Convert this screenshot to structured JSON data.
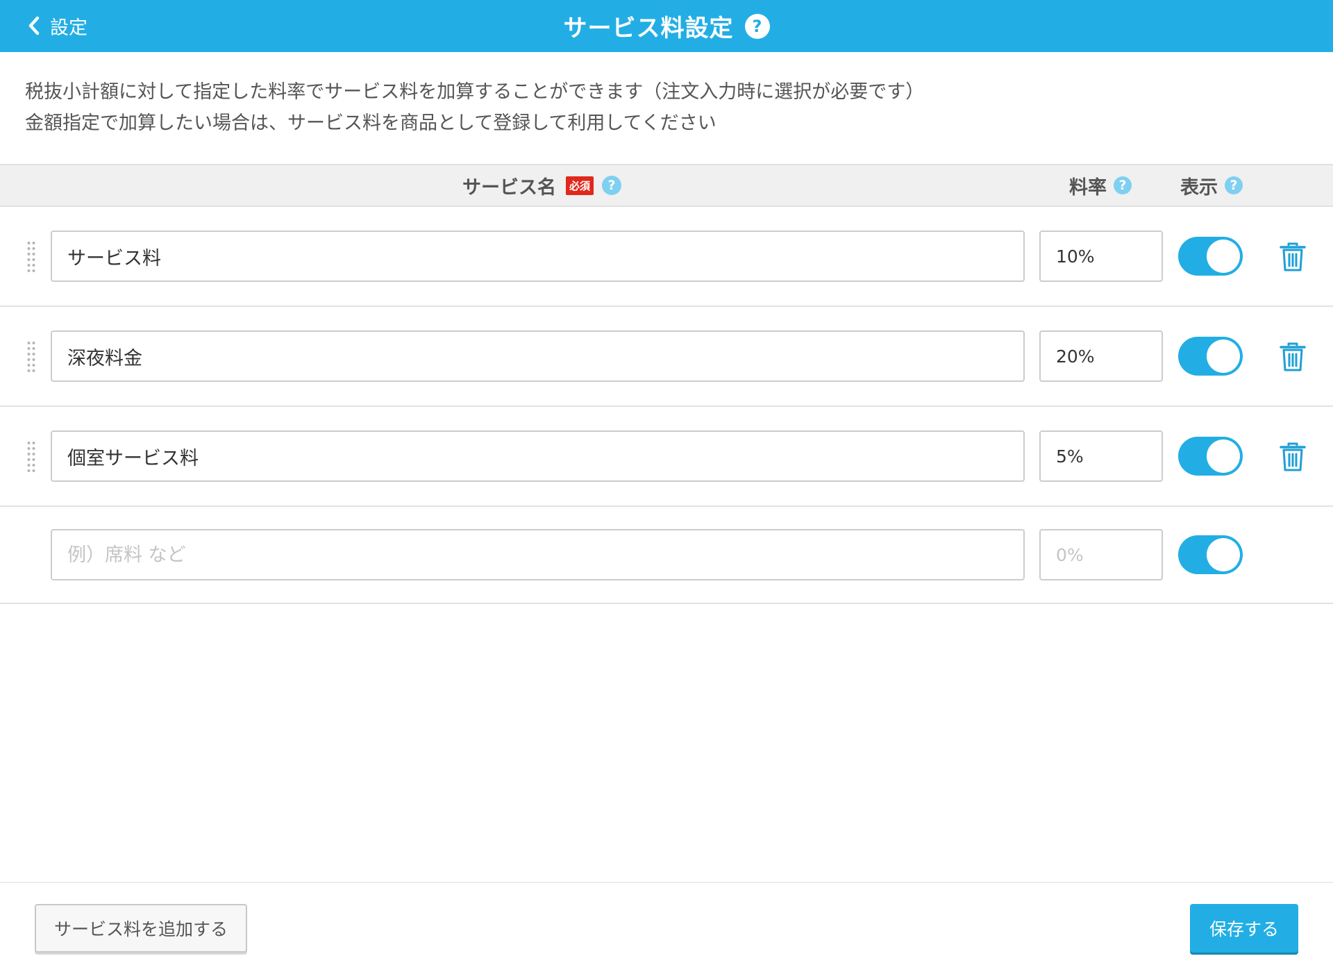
{
  "header": {
    "back_label": "設定",
    "title": "サービス料設定",
    "help_glyph": "?",
    "accent_color": "#22aee4"
  },
  "description": {
    "line1": "税抜小計額に対して指定した料率でサービス料を加算することができます（注文入力時に選択が必要です）",
    "line2": "金額指定で加算したい場合は、サービス料を商品として登録して利用してください"
  },
  "table": {
    "columns": {
      "name": "サービス名",
      "required_badge": "必須",
      "rate": "料率",
      "display": "表示"
    },
    "rows": [
      {
        "name": "サービス料",
        "rate": "10%",
        "display": true
      },
      {
        "name": "深夜料金",
        "rate": "20%",
        "display": true
      },
      {
        "name": "個室サービス料",
        "rate": "5%",
        "display": true
      }
    ],
    "new_row": {
      "name_placeholder": "例）席料 など",
      "rate_placeholder": "0%",
      "display": true
    }
  },
  "footer": {
    "add_label": "サービス料を追加する",
    "save_label": "保存する"
  },
  "icons": {
    "back": "chevron-left-icon",
    "help": "question-circle-icon",
    "drag": "drag-handle-icon",
    "delete": "trash-icon"
  }
}
